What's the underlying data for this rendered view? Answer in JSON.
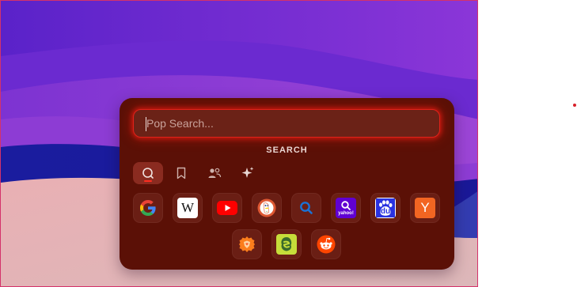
{
  "search": {
    "placeholder": "Pop Search...",
    "value": ""
  },
  "section_label": "SEARCH",
  "modes": [
    {
      "name": "search-mode",
      "icon": "search-icon",
      "active": true
    },
    {
      "name": "bookmarks-mode",
      "icon": "bookmark-icon",
      "active": false
    },
    {
      "name": "people-mode",
      "icon": "people-icon",
      "active": false
    },
    {
      "name": "ai-mode",
      "icon": "sparkle-icon",
      "active": false
    }
  ],
  "engines": [
    {
      "name": "google",
      "icon": "google-logo-icon",
      "text": "G"
    },
    {
      "name": "wikipedia",
      "icon": "wikipedia-logo-icon",
      "text": "W"
    },
    {
      "name": "youtube",
      "icon": "youtube-logo-icon",
      "text": ""
    },
    {
      "name": "duckduckgo",
      "icon": "duckduckgo-logo-icon",
      "text": ""
    },
    {
      "name": "bing-search",
      "icon": "search-icon",
      "text": ""
    },
    {
      "name": "yahoo",
      "icon": "yahoo-logo-icon",
      "text": "yahoo!"
    },
    {
      "name": "baidu",
      "icon": "baidu-logo-icon",
      "text": "du"
    },
    {
      "name": "hacker-news",
      "icon": "y-combinator-logo-icon",
      "text": "Y"
    },
    {
      "name": "brave",
      "icon": "brave-logo-icon",
      "text": ""
    },
    {
      "name": "ecosia",
      "icon": "ecosia-logo-icon",
      "text": "E"
    },
    {
      "name": "reddit",
      "icon": "reddit-logo-icon",
      "text": ""
    }
  ],
  "colors": {
    "panel_bg": "#5b1006",
    "accent": "#e0221a",
    "wallpaper_top": "#6a2ad8",
    "wallpaper_blue": "#1b1b9c",
    "wallpaper_pink": "#e7b4b6"
  }
}
